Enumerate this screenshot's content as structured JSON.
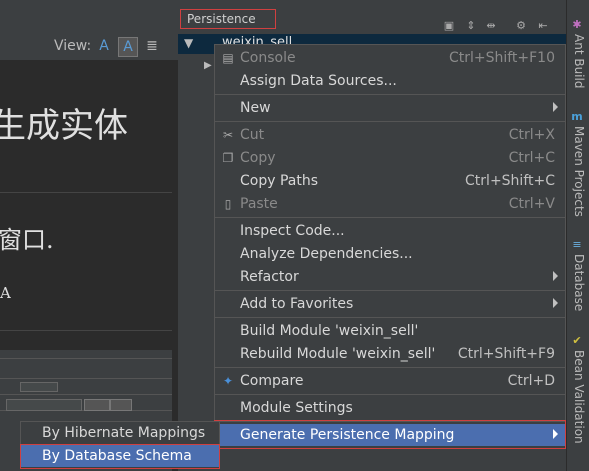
{
  "panel": {
    "title": "Persistence"
  },
  "tree": {
    "root_label": "weixin_sell"
  },
  "editor": {
    "view_label": "View:",
    "view_modes": [
      "A",
      "A",
      "≣"
    ],
    "heading_fragment": "生成实体",
    "line2_fragment": "窗口.",
    "line3_fragment": "A"
  },
  "menu": {
    "console": {
      "label": "Console",
      "shortcut": "Ctrl+Shift+F10"
    },
    "assign": {
      "label": "Assign Data Sources..."
    },
    "new": {
      "label": "New"
    },
    "cut": {
      "label": "Cut",
      "shortcut": "Ctrl+X"
    },
    "copy": {
      "label": "Copy",
      "shortcut": "Ctrl+C"
    },
    "copy_paths": {
      "label": "Copy Paths",
      "shortcut": "Ctrl+Shift+C"
    },
    "paste": {
      "label": "Paste",
      "shortcut": "Ctrl+V"
    },
    "inspect": {
      "label": "Inspect Code..."
    },
    "analyze": {
      "label": "Analyze Dependencies..."
    },
    "refactor": {
      "label": "Refactor"
    },
    "favorites": {
      "label": "Add to Favorites"
    },
    "build": {
      "label": "Build Module 'weixin_sell'"
    },
    "rebuild": {
      "label": "Rebuild Module 'weixin_sell'",
      "shortcut": "Ctrl+Shift+F9"
    },
    "compare": {
      "label": "Compare",
      "shortcut": "Ctrl+D"
    },
    "module_settings": {
      "label": "Module Settings"
    },
    "gpm": {
      "label": "Generate Persistence Mapping"
    }
  },
  "submenu": {
    "hibernate": {
      "label": "By Hibernate Mappings"
    },
    "database": {
      "label": "By Database Schema"
    }
  },
  "strip": {
    "ant": "Ant Build",
    "maven": "Maven Projects",
    "database": "Database",
    "bean": "Bean Validation"
  },
  "colors": {
    "selection": "#4b6eaf",
    "highlight_box": "#d04040",
    "background": "#3c3f41"
  }
}
